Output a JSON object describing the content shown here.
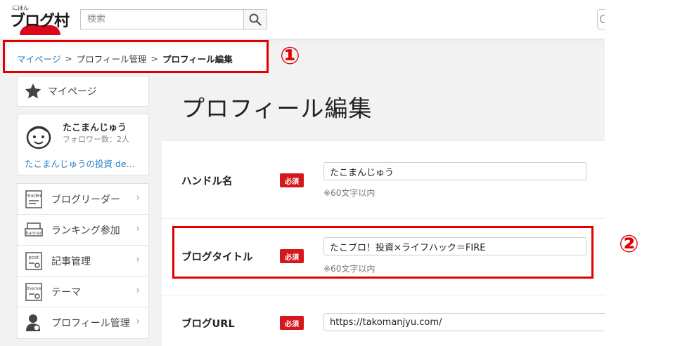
{
  "header": {
    "logo_kana": "にほん",
    "logo_name": "ブログ村",
    "search_placeholder": "検索"
  },
  "breadcrumb": {
    "items": [
      "マイページ",
      "プロフィール管理",
      "プロフィール編集"
    ],
    "separator": ">"
  },
  "sidebar": {
    "mypage_label": "マイページ",
    "profile": {
      "name": "たこまんじゅう",
      "followers": "フォロワー数：2人",
      "blog": "たこまんじゅうの投資 de…"
    },
    "menu": [
      {
        "label": "ブログリーダー",
        "icon": "reader-icon",
        "icon_text": "reader"
      },
      {
        "label": "ランキング参加",
        "icon": "banner-icon",
        "icon_text": "banner"
      },
      {
        "label": "記事管理",
        "icon": "post-icon",
        "icon_text": "post"
      },
      {
        "label": "テーマ",
        "icon": "theme-icon",
        "icon_text": "theme"
      },
      {
        "label": "プロフィール管理",
        "icon": "profile-user-icon"
      }
    ],
    "chevron": "›"
  },
  "main": {
    "title": "プロフィール編集",
    "required_badge": "必須",
    "fields": [
      {
        "label": "ハンドル名",
        "value": "たこまんじゅう",
        "hint": "※60文字以内"
      },
      {
        "label": "ブログタイトル",
        "value": "たこブロ！投資×ライフハック＝FIRE",
        "hint": "※60文字以内"
      },
      {
        "label": "ブログURL",
        "value": "https://takomanjyu.com/"
      }
    ]
  },
  "annotations": {
    "marker_1": "①",
    "marker_2": "②",
    "color": "#e00000"
  },
  "colors": {
    "link": "#2b7fc3",
    "required_badge": "#d6171c",
    "logo_red": "#d9091b"
  }
}
